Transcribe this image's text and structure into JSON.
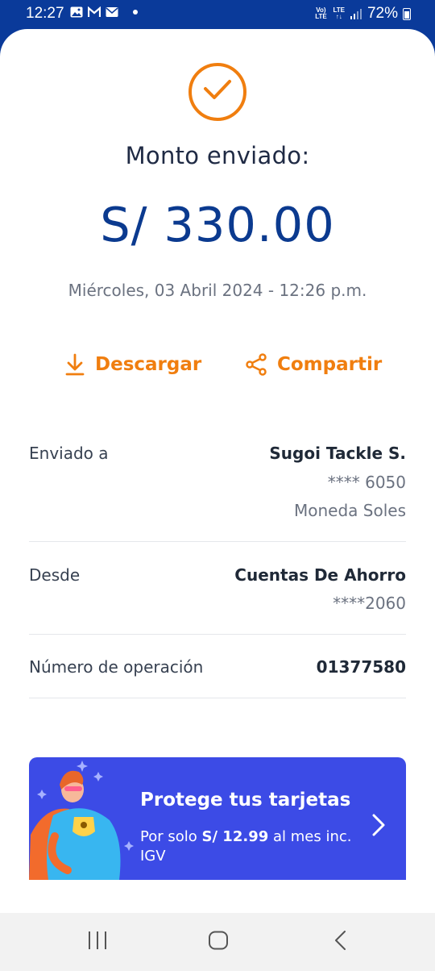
{
  "status_bar": {
    "time": "12:27",
    "battery": "72%",
    "net_top": "Vo) LTE",
    "net_lte": "LTE",
    "net_arrows": "↑↓"
  },
  "receipt": {
    "title": "Monto enviado:",
    "amount": "S/ 330.00",
    "datetime": "Miércoles, 03 Abril 2024 - 12:26 p.m.",
    "download_label": "Descargar",
    "share_label": "Compartir"
  },
  "details": {
    "sent_to_label": "Enviado a",
    "sent_to_name": "Sugoi Tackle S.",
    "sent_to_account": "**** 6050",
    "sent_to_currency": "Moneda Soles",
    "from_label": "Desde",
    "from_name": "Cuentas De Ahorro",
    "from_account": "****2060",
    "operation_label": "Número de operación",
    "operation_number": "01377580"
  },
  "promo": {
    "title": "Protege tus tarjetas",
    "sub_prefix": "Por solo",
    "sub_price": "S/ 12.99",
    "sub_suffix": "al mes inc. IGV"
  },
  "colors": {
    "accent": "#f07e0f",
    "brand": "#0b3a8f",
    "promo": "#3c4be6"
  }
}
